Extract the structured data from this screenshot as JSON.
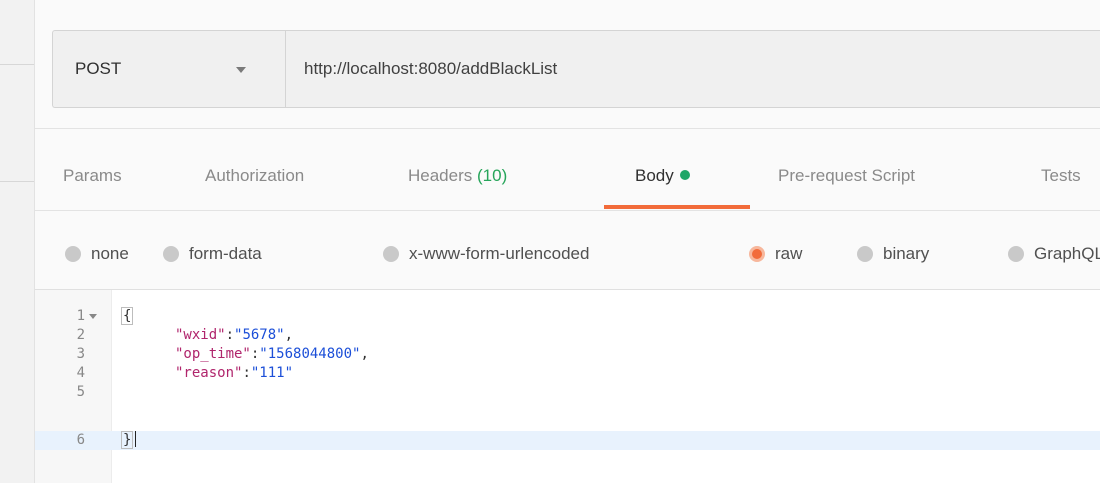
{
  "request": {
    "method": "POST",
    "url": "http://localhost:8080/addBlackList"
  },
  "tabs": [
    {
      "label": "Params"
    },
    {
      "label": "Authorization"
    },
    {
      "label": "Headers",
      "count": "(10)"
    },
    {
      "label": "Body",
      "active": true
    },
    {
      "label": "Pre-request Script"
    },
    {
      "label": "Tests"
    }
  ],
  "body_types": [
    {
      "label": "none"
    },
    {
      "label": "form-data"
    },
    {
      "label": "x-www-form-urlencoded"
    },
    {
      "label": "raw",
      "selected": true
    },
    {
      "label": "binary"
    },
    {
      "label": "GraphQL"
    }
  ],
  "editor": {
    "line_numbers": [
      "1",
      "2",
      "3",
      "4",
      "5",
      "6"
    ],
    "open_brace": "{",
    "close_brace": "}",
    "entries": [
      {
        "key": "\"wxid\"",
        "sep": ":",
        "value": "\"5678\"",
        "trail": ","
      },
      {
        "key": "\"op_time\"",
        "sep": ":",
        "value": "\"1568044800\"",
        "trail": ","
      },
      {
        "key": "\"reason\"",
        "sep": ":",
        "value": "\"111\"",
        "trail": ""
      }
    ]
  },
  "colors": {
    "accent": "#f26b3a",
    "body_dot": "#1fa667",
    "count": "#26a55a",
    "json_key": "#b0256c",
    "json_string": "#1c4fd8",
    "active_line": "#e8f2fd"
  },
  "icons": {
    "method_dropdown": "chevron-down-icon",
    "fold": "fold-triangle-icon",
    "status_dot": "green-dot-icon"
  }
}
